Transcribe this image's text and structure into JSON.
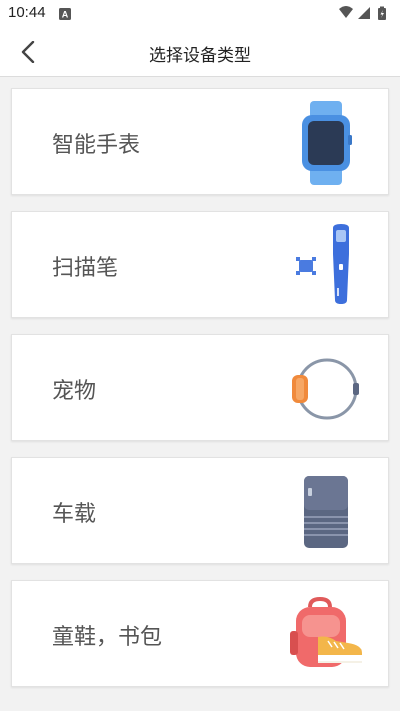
{
  "status_bar": {
    "time": "10:44",
    "icons": [
      "notification-a-icon",
      "wifi-icon",
      "signal-icon",
      "battery-icon"
    ]
  },
  "header": {
    "title": "选择设备类型",
    "back_icon": "chevron-left-icon"
  },
  "device_types": [
    {
      "label": "智能手表",
      "icon": "smartwatch-icon"
    },
    {
      "label": "扫描笔",
      "icon": "scan-pen-icon"
    },
    {
      "label": "宠物",
      "icon": "pet-tracker-icon"
    },
    {
      "label": "车载",
      "icon": "car-device-icon"
    },
    {
      "label": "童鞋，书包",
      "icon": "backpack-shoe-icon"
    }
  ],
  "colors": {
    "background": "#f2f2f2",
    "card": "#ffffff",
    "label_text": "#555555",
    "watch_blue": "#4a90e2",
    "pen_blue": "#3d6fdc",
    "pet_orange": "#f08a3c",
    "car_slate": "#5b6782",
    "bag_red": "#f06a6a"
  }
}
